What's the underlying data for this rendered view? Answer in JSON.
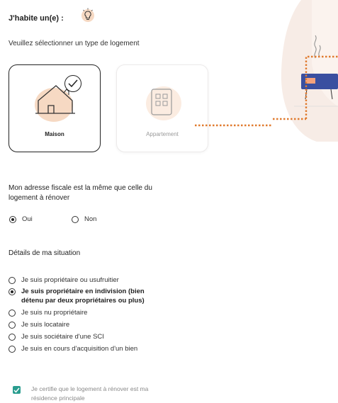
{
  "header": {
    "title": "J'habite un(e) :",
    "subtitle": "Veuillez sélectionner un type de logement"
  },
  "housing_types": [
    {
      "label": "Maison",
      "selected": true
    },
    {
      "label": "Appartement",
      "selected": false
    }
  ],
  "fiscal_address": {
    "question_line1": "Mon adresse fiscale est la même que celle du",
    "question_line2": "logement à rénover",
    "options": [
      {
        "label": "Oui",
        "selected": true
      },
      {
        "label": "Non",
        "selected": false
      }
    ]
  },
  "situation": {
    "heading": "Détails de ma situation",
    "options": [
      {
        "label": "Je suis propriétaire ou usufruitier",
        "selected": false
      },
      {
        "label": "Je suis propriétaire en indivision (bien",
        "label2": "détenu par deux propriétaires ou plus)",
        "selected": true
      },
      {
        "label": "Je suis nu propriétaire",
        "selected": false
      },
      {
        "label": "Je suis locataire",
        "selected": false
      },
      {
        "label": "Je suis sociétaire d'une SCI",
        "selected": false
      },
      {
        "label": "Je suis en cours d'acquisition d'un bien",
        "selected": false
      }
    ]
  },
  "certify": {
    "checked": true,
    "line1": "Je certifie que le logement à rénover est ma",
    "line2": "résidence principale"
  },
  "colors": {
    "accent_orange": "#e07a2e",
    "peach": "#f6d9c3",
    "checkbox_teal": "#2a9d8f",
    "furniture_blue": "#3a4fa0"
  }
}
